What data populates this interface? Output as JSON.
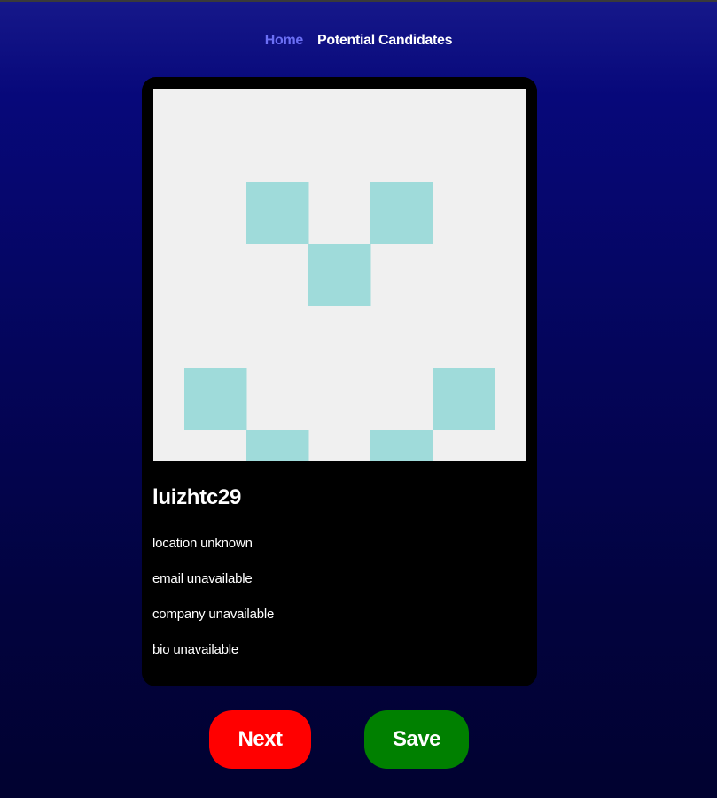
{
  "nav": {
    "home_label": "Home",
    "candidates_label": "Potential Candidates"
  },
  "candidate": {
    "username": "luizhtc29",
    "location": "location unknown",
    "email": "email unavailable",
    "company": "company unavailable",
    "bio": "bio unavailable",
    "avatar": {
      "icon": "identicon-avatar-icon",
      "background_color": "#f0f0f0",
      "block_color": "#9fdbda",
      "pattern": [
        [
          0,
          0,
          0,
          0,
          0,
          0
        ],
        [
          0,
          1,
          0,
          1,
          0,
          0
        ],
        [
          0,
          0,
          1,
          0,
          0,
          0
        ],
        [
          0,
          0,
          0,
          0,
          0,
          0
        ],
        [
          1,
          0,
          0,
          0,
          1,
          0
        ],
        [
          0,
          1,
          0,
          1,
          0,
          0
        ]
      ]
    }
  },
  "actions": {
    "next_label": "Next",
    "save_label": "Save"
  },
  "colors": {
    "home_link": "#6b6ff5",
    "next_button": "#ff0000",
    "save_button": "#008000"
  }
}
